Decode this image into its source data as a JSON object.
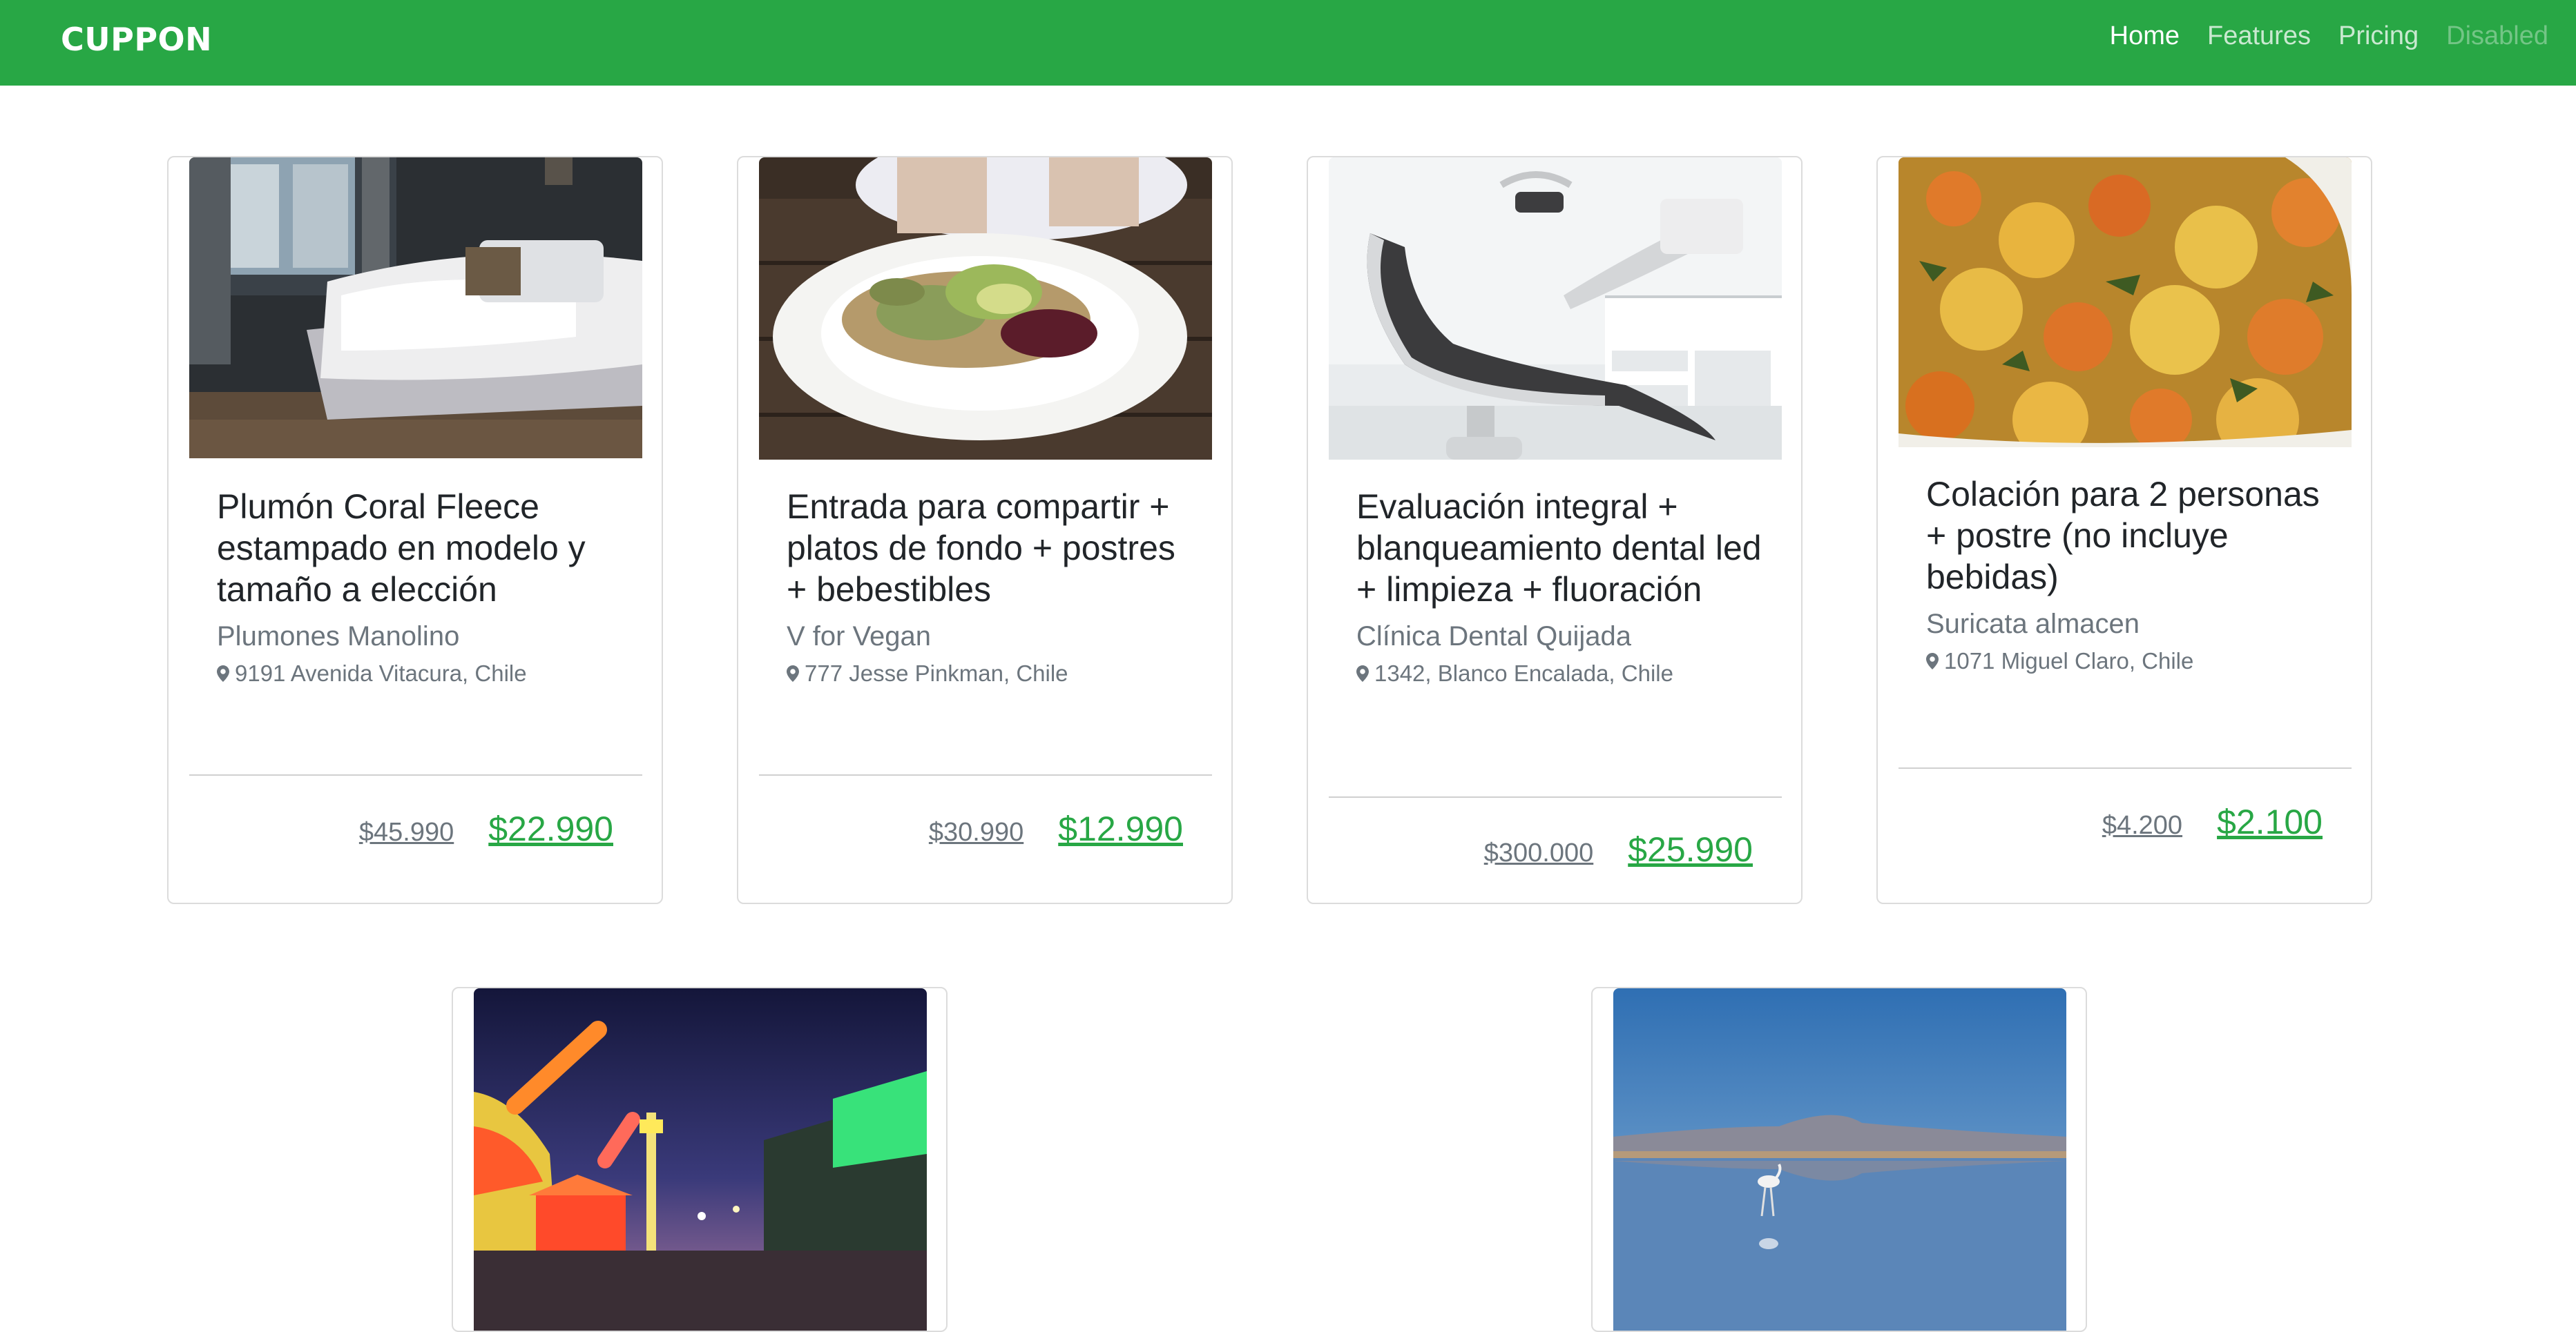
{
  "navbar": {
    "brand": "CUPPON",
    "bg_color": "#28a745",
    "links": [
      {
        "label": "Home",
        "state": "active"
      },
      {
        "label": "Features",
        "state": "normal"
      },
      {
        "label": "Pricing",
        "state": "normal"
      },
      {
        "label": "Disabled",
        "state": "disabled"
      }
    ]
  },
  "theme": {
    "accent": "#28a745",
    "muted": "#6c757d"
  },
  "deals": [
    {
      "title": "Plumón Coral Fleece estampado en modelo y tamaño a elección",
      "merchant": "Plumones Manolino",
      "address": "9191 Avenida Vitacura, Chile",
      "old_price": "$45.990",
      "new_price": "$22.990",
      "image": "bedroom-bed-photo"
    },
    {
      "title": "Entrada para compartir + platos de fondo + postres + bebestibles",
      "merchant": "V for Vegan",
      "address": "777 Jesse Pinkman, Chile",
      "old_price": "$30.990",
      "new_price": "$12.990",
      "image": "salad-plate-photo"
    },
    {
      "title": "Evaluación integral + blanqueamiento dental led + limpieza + fluoración",
      "merchant": "Clínica Dental Quijada",
      "address": "1342, Blanco Encalada, Chile",
      "old_price": "$300.000",
      "new_price": "$25.990",
      "image": "dental-chair-photo"
    },
    {
      "title": "Colación para 2 personas + postre (no incluye bebidas)",
      "merchant": "Suricata almacen",
      "address": "1071 Miguel Claro, Chile",
      "old_price": "$4.200",
      "new_price": "$2.100",
      "image": "vegetable-stew-photo"
    },
    {
      "image": "amusement-park-night-photo"
    },
    {
      "image": "flamingo-lake-photo"
    }
  ],
  "icons": {
    "address": "map-marker-icon"
  }
}
